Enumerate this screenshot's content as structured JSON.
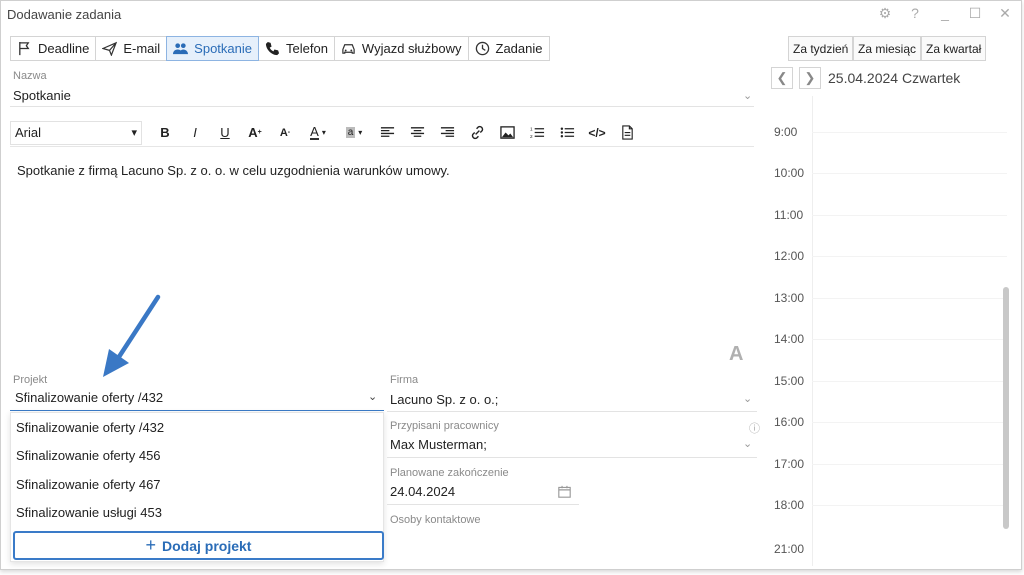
{
  "window": {
    "title": "Dodawanie zadania"
  },
  "types": [
    {
      "label": "Deadline",
      "icon": "flag-icon"
    },
    {
      "label": "E-mail",
      "icon": "paper-plane-icon"
    },
    {
      "label": "Spotkanie",
      "icon": "people-icon",
      "active": true
    },
    {
      "label": "Telefon",
      "icon": "phone-icon"
    },
    {
      "label": "Wyjazd służbowy",
      "icon": "car-icon"
    },
    {
      "label": "Zadanie",
      "icon": "clock-icon"
    }
  ],
  "name_field": {
    "label": "Nazwa",
    "value": "Spotkanie"
  },
  "editor": {
    "font": "Arial",
    "content": "Spotkanie z firmą Lacuno Sp. z o. o. w celu uzgodnienia warunków umowy.",
    "corner_mark": "A"
  },
  "project": {
    "label": "Projekt",
    "value": "Sfinalizowanie oferty /432",
    "options": [
      "Sfinalizowanie oferty /432",
      "Sfinalizowanie oferty 456",
      "Sfinalizowanie oferty 467",
      "Sfinalizowanie usługi 453"
    ],
    "add_label": "Dodaj projekt"
  },
  "company": {
    "label": "Firma",
    "value": "Lacuno Sp. z o. o.;"
  },
  "employees": {
    "label": "Przypisani pracownicy",
    "value": "Max Musterman;"
  },
  "deadline": {
    "label": "Planowane zakończenie",
    "value": "24.04.2024"
  },
  "contacts": {
    "label": "Osoby kontaktowe"
  },
  "calendar": {
    "ranges": [
      "Za tydzień",
      "Za miesiąc",
      "Za kwartał"
    ],
    "date": "25.04.2024 Czwartek",
    "hours": [
      "9:00",
      "10:00",
      "11:00",
      "12:00",
      "13:00",
      "14:00",
      "15:00",
      "16:00",
      "17:00",
      "18:00",
      "21:00"
    ]
  },
  "colors": {
    "accent": "#2a6cb7",
    "arrow": "#3a78c5",
    "active_bg": "#e6f0fb"
  }
}
